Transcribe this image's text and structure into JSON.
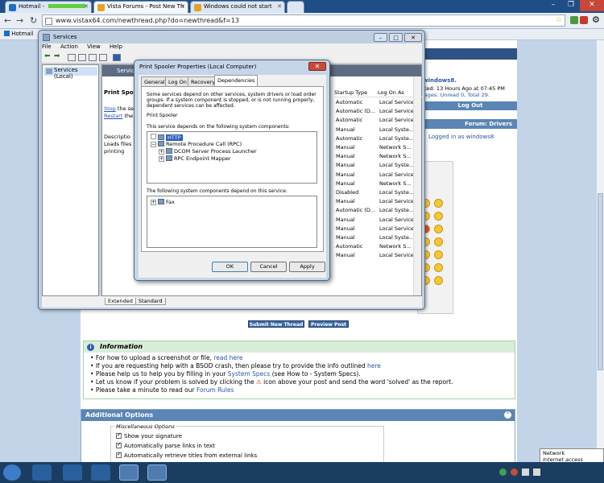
{
  "browser": {
    "tabs": [
      {
        "label": "Hotmail -"
      },
      {
        "label": "Vista Forums - Post New Th"
      },
      {
        "label": "Windows could not start"
      }
    ],
    "url": "www.vistax64.com/newthread.php?do=newthread&f=13",
    "bookmark": "Hotmail"
  },
  "forum": {
    "user_greeting": ", windows8.",
    "last_visited": "isited: 13 Hours Ago at 07:45 PM",
    "messages": "ssages: Unread 0, Total 29.",
    "logout": "Log Out",
    "forum_label": "Forum: Drivers",
    "logged_in": "Logged in as windows8",
    "submit_btn": "Submit New Thread",
    "preview_btn": "Preview Post",
    "info_title": "Information",
    "info_items": [
      {
        "pre": "For how to upload a screenshot or file, ",
        "link": "read here",
        "post": ""
      },
      {
        "pre": "If you are requesting help with a BSOD crash, then please try to provide the info outlined ",
        "link": "here",
        "post": ""
      },
      {
        "pre": "Please help us to help you by filling in your ",
        "link": "System Specs",
        "post": " (see How to - System Specs)."
      },
      {
        "pre": "Let us know if your problem is solved by clicking the ",
        "link": "",
        "post": " icon above your post and send the word 'solved' as the report."
      },
      {
        "pre": "Please take a minute to read our ",
        "link": "Forum Rules",
        "post": ""
      }
    ],
    "additional_options": "Additional Options",
    "misc_options": "Miscellaneous Options",
    "options": [
      "Show your signature",
      "Automatically parse links in text",
      "Automatically retrieve titles from external links"
    ]
  },
  "services": {
    "title": "Services",
    "menu": [
      "File",
      "Action",
      "View",
      "Help"
    ],
    "tree_item": "Services (Local)",
    "right_header": "Servic",
    "selected_name": "Print Spool",
    "stop_link": "Stop",
    "stop_rest": " the se",
    "restart_link": "Restart",
    "restart_rest": " the",
    "desc_label": "Descriptio",
    "desc_1": "Loads files",
    "desc_2": "printing",
    "col_startup": "Startup Type",
    "col_logon": "Log On As",
    "rows": [
      {
        "s": "Automatic",
        "l": "Local Service"
      },
      {
        "s": "Automatic (D...",
        "l": "Local Service"
      },
      {
        "s": "Automatic",
        "l": "Local Service"
      },
      {
        "s": "Manual",
        "l": "Local Syste..."
      },
      {
        "s": "Automatic",
        "l": "Local Syste..."
      },
      {
        "s": "Manual",
        "l": "Network S..."
      },
      {
        "s": "Manual",
        "l": "Network S..."
      },
      {
        "s": "Manual",
        "l": "Local Syste..."
      },
      {
        "s": "Manual",
        "l": "Local Service"
      },
      {
        "s": "Manual",
        "l": "Network S..."
      },
      {
        "s": "Disabled",
        "l": "Local Syste..."
      },
      {
        "s": "Manual",
        "l": "Local Service"
      },
      {
        "s": "Automatic (D...",
        "l": "Local Syste..."
      },
      {
        "s": "Manual",
        "l": "Local Service"
      },
      {
        "s": "Manual",
        "l": "Local Service"
      },
      {
        "s": "Manual",
        "l": "Local Syste..."
      },
      {
        "s": "Automatic",
        "l": "Network S..."
      },
      {
        "s": "Manual",
        "l": "Local Service"
      }
    ],
    "tab_extended": "Extended",
    "tab_standard": "Standard"
  },
  "dialog": {
    "title": "Print Spooler Properties (Local Computer)",
    "close": "✕",
    "tabs": [
      "General",
      "Log On",
      "Recovery",
      "Dependencies"
    ],
    "intro_1": "Some services depend on other services, system drivers or load order",
    "intro_2": "groups. If a system component is stopped, or is not running properly,",
    "intro_3": "dependent services can be affected.",
    "service_name": "Print Spooler",
    "depends_on_label": "This service depends on the following system components:",
    "depends_on": [
      "HTTP",
      "Remote Procedure Call (RPC)",
      "DCOM Server Process Launcher",
      "RPC Endpoint Mapper"
    ],
    "dependents_label": "The following system components depend on this service:",
    "dependents": [
      "Fax"
    ],
    "ok": "OK",
    "cancel": "Cancel",
    "apply": "Apply"
  },
  "taskbar": {
    "network_title": "Network",
    "network_status": "Internet access"
  },
  "colors": {
    "titlebar": "#1f4d86",
    "forum_blue": "#5a85b5",
    "info_green": "#d9eed9",
    "selected_node": "#2b5fb6"
  }
}
